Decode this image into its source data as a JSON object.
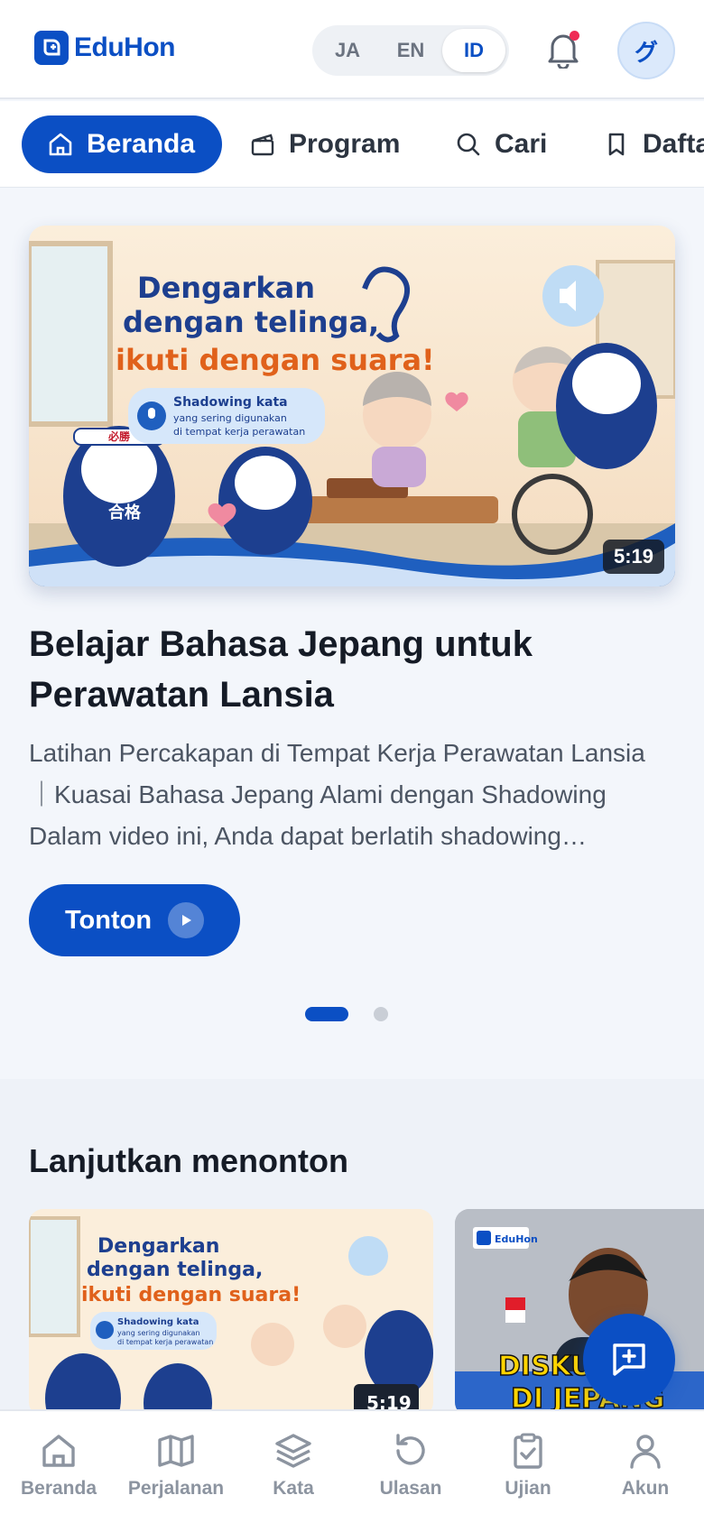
{
  "header": {
    "logo_text": "EduHon",
    "languages": [
      {
        "code": "JA",
        "active": false
      },
      {
        "code": "EN",
        "active": false
      },
      {
        "code": "ID",
        "active": true
      }
    ],
    "avatar_initial": "グ"
  },
  "tabs": [
    {
      "label": "Beranda",
      "icon": "home-icon",
      "active": true
    },
    {
      "label": "Program",
      "icon": "clapperboard-icon",
      "active": false
    },
    {
      "label": "Cari",
      "icon": "search-icon",
      "active": false
    },
    {
      "label": "Daftar",
      "icon": "bookmark-icon",
      "active": false
    }
  ],
  "hero": {
    "thumbnail": {
      "headline_line1": "Dengarkan",
      "headline_line2": "dengan telinga,",
      "headline_line3": "ikuti dengan suara!",
      "badge_title": "Shadowing kata",
      "badge_line2": "yang sering digunakan",
      "badge_line3": "di tempat kerja perawatan",
      "headband_text": "必勝",
      "belly_text": "合格"
    },
    "duration": "5:19",
    "title": "Belajar Bahasa Jepang untuk Perawatan Lansia",
    "description": "Latihan Percakapan di Tempat Kerja Perawatan Lansia ｜Kuasai Bahasa Jepang Alami dengan Shadowing Dalam video ini, Anda dapat berlatih shadowing…",
    "watch_label": "Tonton",
    "carousel_active_index": 0,
    "carousel_count": 2
  },
  "continue_watching": {
    "title": "Lanjutkan menonton",
    "cards": [
      {
        "duration": "5:19",
        "headline_line1": "Dengarkan",
        "headline_line2": "dengan telinga,",
        "headline_line3": "ikuti dengan suara!",
        "badge_title": "Shadowing kata",
        "badge_line2": "yang sering digunakan",
        "badge_line3": "di tempat kerja perawatan"
      },
      {
        "brand": "EduHon",
        "caption_line1": "DISKUSI",
        "caption_line2": "DI JEPANG"
      }
    ]
  },
  "bottom_nav": [
    {
      "label": "Beranda",
      "icon": "home-icon"
    },
    {
      "label": "Perjalanan",
      "icon": "map-icon"
    },
    {
      "label": "Kata",
      "icon": "layers-icon"
    },
    {
      "label": "Ulasan",
      "icon": "rotate-icon"
    },
    {
      "label": "Ujian",
      "icon": "clipboard-check-icon"
    },
    {
      "label": "Akun",
      "icon": "user-icon"
    }
  ],
  "colors": {
    "brand": "#0b4fc4",
    "notification": "#ef2b55",
    "muted": "#8c94a0"
  }
}
